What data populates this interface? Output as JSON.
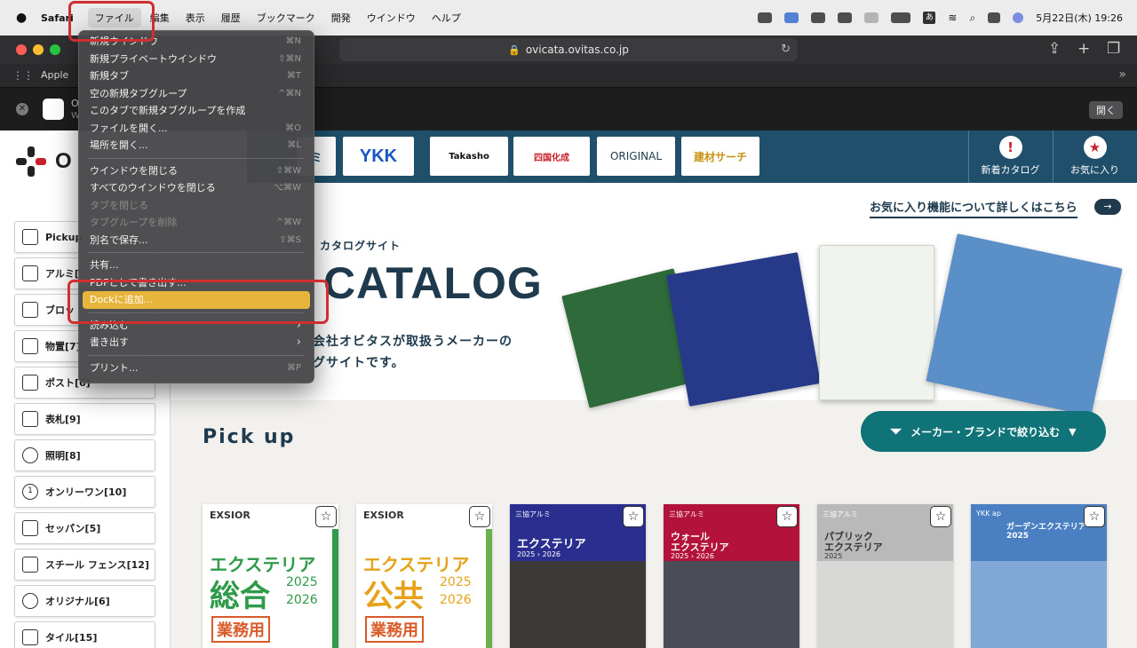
{
  "menubar": {
    "app_name": "Safari",
    "items": [
      "ファイル",
      "編集",
      "表示",
      "履歴",
      "ブックマーク",
      "開発",
      "ウインドウ",
      "ヘルプ"
    ],
    "ime_label": "あ",
    "clock": "5月22日(木) 19:26"
  },
  "browser": {
    "url": "ovicata.ovitas.co.jp",
    "favorite": "Apple",
    "banner_app_name": "O",
    "banner_app_sub": "W",
    "open_label": "開く"
  },
  "file_menu": {
    "items": [
      {
        "label": "新規ウインドウ",
        "shortcut": "⌘N",
        "disabled": false
      },
      {
        "label": "新規プライベートウインドウ",
        "shortcut": "⇧⌘N",
        "disabled": false
      },
      {
        "label": "新規タブ",
        "shortcut": "⌘T",
        "disabled": false
      },
      {
        "label": "空の新規タブグループ",
        "shortcut": "^⌘N",
        "disabled": false
      },
      {
        "label": "このタブで新規タブグループを作成",
        "shortcut": "",
        "disabled": false
      },
      {
        "label": "ファイルを開く...",
        "shortcut": "⌘O",
        "disabled": false
      },
      {
        "label": "場所を開く...",
        "shortcut": "⌘L",
        "disabled": false
      },
      {
        "label": "ウインドウを閉じる",
        "shortcut": "⇧⌘W",
        "disabled": false
      },
      {
        "label": "すべてのウインドウを閉じる",
        "shortcut": "⌥⌘W",
        "disabled": false
      },
      {
        "label": "タブを閉じる",
        "shortcut": "",
        "disabled": true
      },
      {
        "label": "タブグループを削除",
        "shortcut": "^⌘W",
        "disabled": true
      },
      {
        "label": "別名で保存...",
        "shortcut": "⇧⌘S",
        "disabled": false
      },
      {
        "label": "共有...",
        "shortcut": "",
        "disabled": false
      },
      {
        "label": "PDFとして書き出す...",
        "shortcut": "",
        "disabled": false
      },
      {
        "label": "Dockに追加...",
        "shortcut": "",
        "disabled": false,
        "selected": true
      },
      {
        "label": "読み込む",
        "shortcut": "›",
        "disabled": false
      },
      {
        "label": "書き出す",
        "shortcut": "›",
        "disabled": false
      },
      {
        "label": "プリント...",
        "shortcut": "⌘P",
        "disabled": false
      }
    ]
  },
  "site": {
    "logo_word": "O",
    "makers": [
      "ミ",
      "YKK",
      "Takasho",
      "四国化成",
      "ORIGINAL",
      "建材サーチ"
    ],
    "new_catalog_label": "新着カタログ",
    "favorites_label": "お気に入り",
    "fav_link": "お気に入り機能について詳しくはこちら",
    "hero_sub": "カタログサイト",
    "hero_big": "CATALOG",
    "hero_desc1": "会社オビタスが取扱うメーカーの",
    "hero_desc2": "グサイトです。",
    "pickup_title": "Pick up",
    "filter_label": "メーカー・ブランドで絞り込む",
    "categories": [
      {
        "label": "Pickup",
        "icon": "bookmark-icon"
      },
      {
        "label": "アルミ[",
        "icon": "aluminum-icon"
      },
      {
        "label": "ブロッ",
        "icon": "block-icon"
      },
      {
        "label": "物置[7]",
        "icon": "storage-icon"
      },
      {
        "label": "ポスト[6]",
        "icon": "mailbox-icon"
      },
      {
        "label": "表札[9]",
        "icon": "nameplate-icon"
      },
      {
        "label": "照明[8]",
        "icon": "light-icon"
      },
      {
        "label": "オンリーワン[10]",
        "icon": "onlyone-icon"
      },
      {
        "label": "セッパン[5]",
        "icon": "seppan-icon"
      },
      {
        "label": "スチール フェンス[12]",
        "icon": "fence-icon"
      },
      {
        "label": "オリジナル[6]",
        "icon": "original-icon"
      },
      {
        "label": "タイル[15]",
        "icon": "tile-icon"
      }
    ],
    "cards": [
      {
        "brand": "EXSIOR",
        "title1": "エクステリア",
        "title2": "総合",
        "year1": "2025",
        "year2": "2026",
        "badge": "業務用",
        "color": "#2f9a4a"
      },
      {
        "brand": "EXSIOR",
        "title1": "エクステリア",
        "title2": "公共",
        "year1": "2025",
        "year2": "2026",
        "badge": "業務用",
        "color": "#e6a21a"
      },
      {
        "brand": "三協アルミ",
        "title1": "エクステリア",
        "title2": "",
        "year1": "2025 › 2026",
        "year2": "",
        "badge": "",
        "color": "#2a2f8f"
      },
      {
        "brand": "三協アルミ",
        "title1": "ウォール",
        "title2": "エクステリア",
        "year1": "2025 › 2026",
        "year2": "",
        "badge": "",
        "color": "#b3123a"
      },
      {
        "brand": "三協アルミ",
        "title1": "パブリック",
        "title2": "エクステリア",
        "year1": "2025",
        "year2": "",
        "badge": "",
        "color": "#8a8a8a"
      },
      {
        "brand": "YKK ap",
        "title1": "ガーデンエクステリア 2025",
        "title2": "",
        "year1": "",
        "year2": "",
        "badge": "",
        "color": "#4a7fc1"
      }
    ]
  }
}
